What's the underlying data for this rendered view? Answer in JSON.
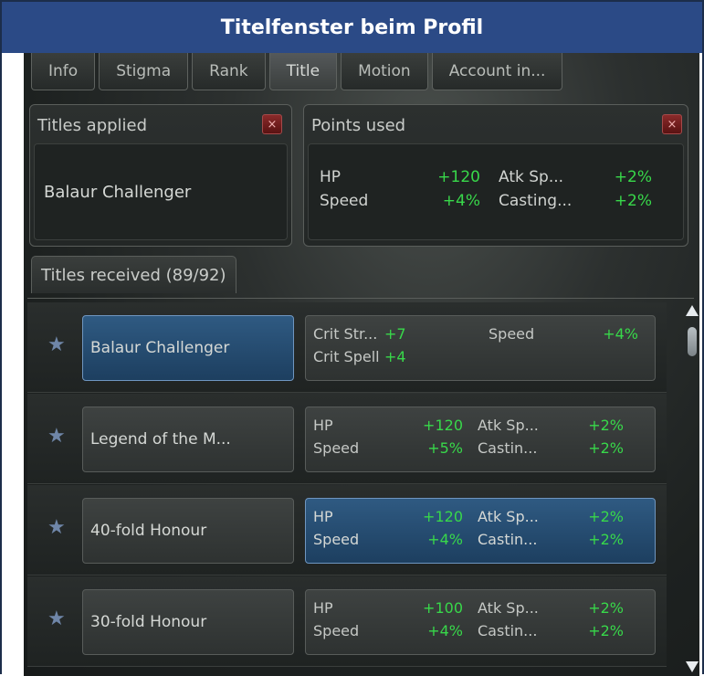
{
  "header": {
    "title": "Titelfenster beim Profil"
  },
  "tabs": [
    "Info",
    "Stigma",
    "Rank",
    "Title",
    "Motion",
    "Account in..."
  ],
  "titles_applied": {
    "label": "Titles applied",
    "close": "×",
    "value": "Balaur Challenger"
  },
  "points_used": {
    "label": "Points used",
    "close": "×",
    "stats": [
      {
        "name": "HP",
        "value": "+120"
      },
      {
        "name": "Atk Sp...",
        "value": "+2%"
      },
      {
        "name": "Speed",
        "value": "+4%"
      },
      {
        "name": "Casting...",
        "value": "+2%"
      }
    ]
  },
  "received": {
    "label": "Titles received (89/92)"
  },
  "titles": [
    {
      "name": "Balaur Challenger",
      "selected": true,
      "stats": [
        {
          "name": "Crit Str...",
          "value": "+7"
        },
        {
          "name": "Speed",
          "value": "+4%"
        },
        {
          "name": "Crit Spell",
          "value": "+4"
        },
        {
          "name": "",
          "value": ""
        }
      ]
    },
    {
      "name": "Legend of the M...",
      "selected": false,
      "stats": [
        {
          "name": "HP",
          "value": "+120"
        },
        {
          "name": "Atk Sp...",
          "value": "+2%"
        },
        {
          "name": "Speed",
          "value": "+5%"
        },
        {
          "name": "Castin...",
          "value": "+2%"
        }
      ]
    },
    {
      "name": "40-fold Honour",
      "selected": false,
      "stats_selected": true,
      "stats": [
        {
          "name": "HP",
          "value": "+120"
        },
        {
          "name": "Atk Sp...",
          "value": "+2%"
        },
        {
          "name": "Speed",
          "value": "+4%"
        },
        {
          "name": "Castin...",
          "value": "+2%"
        }
      ]
    },
    {
      "name": "30-fold Honour",
      "selected": false,
      "stats": [
        {
          "name": "HP",
          "value": "+100"
        },
        {
          "name": "Atk Sp...",
          "value": "+2%"
        },
        {
          "name": "Speed",
          "value": "+4%"
        },
        {
          "name": "Castin...",
          "value": "+2%"
        }
      ]
    }
  ],
  "icons": {
    "star": "star-icon",
    "close": "close-icon",
    "scroll_up": "arrow-up-icon",
    "scroll_down": "arrow-down-icon"
  },
  "colors": {
    "header": "#2b4a86",
    "stat_value": "#38d84a",
    "selected": "#2f5a82"
  }
}
